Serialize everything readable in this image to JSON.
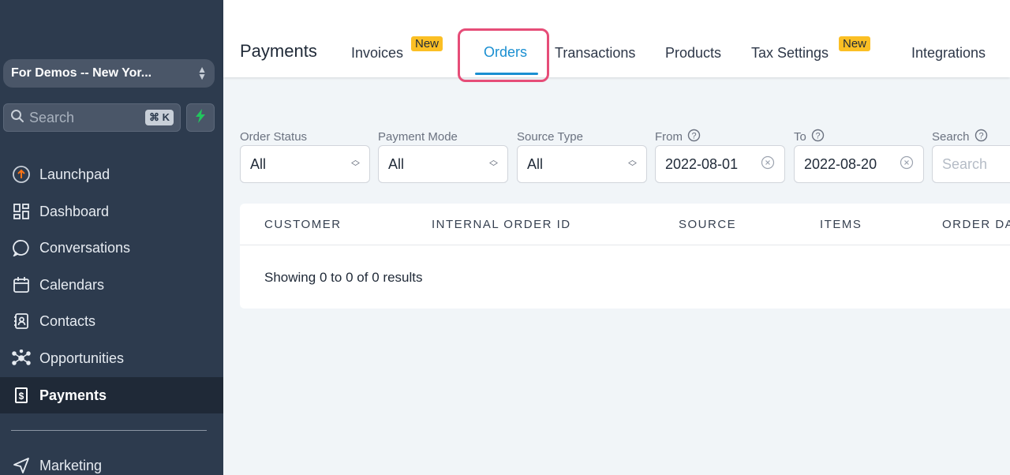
{
  "sidebar": {
    "location": "For Demos -- New Yor...",
    "search": {
      "placeholder": "Search",
      "shortcut": "⌘ K"
    },
    "items": [
      {
        "label": "Launchpad",
        "icon": "launchpad-icon"
      },
      {
        "label": "Dashboard",
        "icon": "dashboard-icon"
      },
      {
        "label": "Conversations",
        "icon": "conversations-icon"
      },
      {
        "label": "Calendars",
        "icon": "calendar-icon"
      },
      {
        "label": "Contacts",
        "icon": "contacts-icon"
      },
      {
        "label": "Opportunities",
        "icon": "opportunities-icon"
      },
      {
        "label": "Payments",
        "icon": "payments-icon",
        "active": true
      },
      {
        "label": "Marketing",
        "icon": "marketing-icon"
      }
    ]
  },
  "header": {
    "title": "Payments",
    "tabs": [
      {
        "label": "Invoices",
        "badge": "New"
      },
      {
        "label": "Orders",
        "active": true
      },
      {
        "label": "Transactions"
      },
      {
        "label": "Products"
      },
      {
        "label": "Tax Settings",
        "badge": "New"
      },
      {
        "label": "Integrations"
      }
    ]
  },
  "filters": {
    "order_status": {
      "label": "Order Status",
      "value": "All"
    },
    "payment_mode": {
      "label": "Payment Mode",
      "value": "All"
    },
    "source_type": {
      "label": "Source Type",
      "value": "All"
    },
    "from": {
      "label": "From",
      "value": "2022-08-01"
    },
    "to": {
      "label": "To",
      "value": "2022-08-20"
    },
    "search": {
      "label": "Search",
      "placeholder": "Search"
    }
  },
  "table": {
    "columns": [
      "CUSTOMER",
      "INTERNAL ORDER ID",
      "SOURCE",
      "ITEMS",
      "ORDER DATE"
    ],
    "results": {
      "prefix": "Showing",
      "from": "0",
      "to_word": "to",
      "to": "0",
      "of_word": "of",
      "total": "0",
      "suffix": "results"
    }
  },
  "colors": {
    "sidebar_bg": "#2d3b4e",
    "accent": "#1a8fd1",
    "highlight": "#e64d78",
    "badge": "#fbbf24",
    "bolt": "#22c55e"
  }
}
